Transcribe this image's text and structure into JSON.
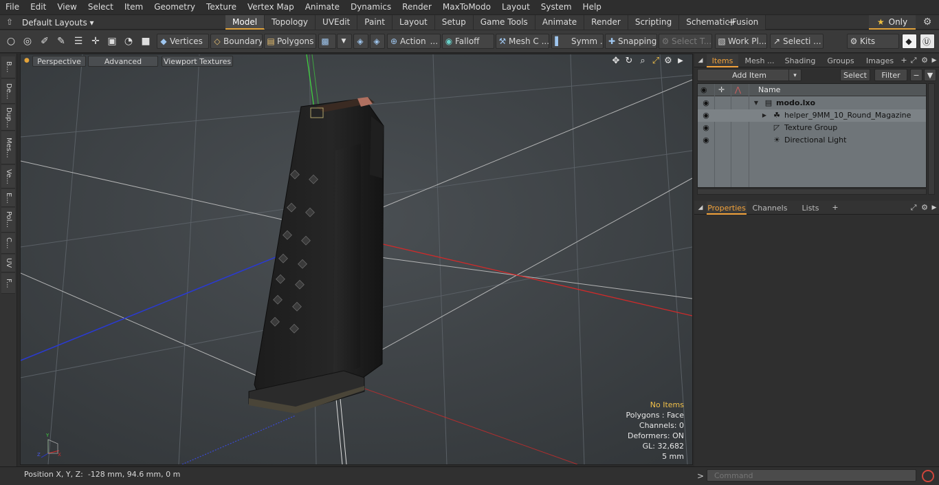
{
  "menu": [
    "File",
    "Edit",
    "View",
    "Select",
    "Item",
    "Geometry",
    "Texture",
    "Vertex Map",
    "Animate",
    "Dynamics",
    "Render",
    "MaxToModo",
    "Layout",
    "System",
    "Help"
  ],
  "layout_bar": {
    "layouts_label": "Default Layouts ▾",
    "tabs": [
      "Model",
      "Topology",
      "UVEdit",
      "Paint",
      "Layout",
      "Setup",
      "Game Tools",
      "Animate",
      "Render",
      "Scripting",
      "Schematic Fusion"
    ],
    "active_tab": "Model",
    "plus": "+",
    "only_label": "Only",
    "star": "★",
    "gear": "⚙"
  },
  "toolbar": {
    "vertices": "Vertices",
    "boundary": "Boundary",
    "polygons": "Polygons",
    "action": "Action",
    "action_more": "...",
    "falloff": "Falloff",
    "mesh_c": "Mesh C ...",
    "symm": "Symm ...",
    "snapping": "Snapping",
    "select_t": "Select T...",
    "work_pl": "Work Pl...",
    "selecti": "Selecti ...",
    "kits": "Kits"
  },
  "left_tabs": [
    "B...",
    "De...",
    "Dup...",
    "Mes...",
    "Ve...",
    "E...",
    "Pol...",
    "C...",
    "UV",
    "F..."
  ],
  "viewport": {
    "tabs": [
      "Perspective",
      "Advanced",
      "Viewport Textures"
    ],
    "info": {
      "no_items": "No Items",
      "polygons": "Polygons : Face",
      "channels": "Channels: 0",
      "deformers": "Deformers: ON",
      "gl": "GL: 32,682",
      "scale": "5 mm"
    },
    "axis_y": "Y",
    "axis_z": "Z",
    "axis_x": "X"
  },
  "items_panel": {
    "tabs": [
      "Items",
      "Mesh ...",
      "Shading",
      "Groups",
      "Images"
    ],
    "active": "Items",
    "plus": "+",
    "add_item": "Add Item",
    "add_item_arrow": "▾",
    "select": "Select",
    "filter": "Filter",
    "col_name": "Name",
    "rows": [
      {
        "label": "modo.lxo",
        "icon": "scene-icon",
        "glyph": "▤",
        "bold": true,
        "arrow": "▼",
        "indent": 0
      },
      {
        "label": "helper_9MM_10_Round_Magazine",
        "icon": "mesh-icon",
        "glyph": "☘",
        "bold": false,
        "arrow": "▶",
        "indent": 1
      },
      {
        "label": "Texture Group",
        "icon": "texture-group-icon",
        "glyph": "◸",
        "bold": false,
        "arrow": "",
        "indent": 1
      },
      {
        "label": "Directional Light",
        "icon": "light-icon",
        "glyph": "☀",
        "bold": false,
        "arrow": "",
        "indent": 1
      }
    ]
  },
  "properties_panel": {
    "tabs": [
      "Properties",
      "Channels",
      "Lists"
    ],
    "active": "Properties",
    "plus": "+"
  },
  "status": {
    "position_label": "Position X, Y, Z:",
    "position_value": "-128 mm, 94.6 mm, 0 m"
  },
  "command": {
    "caret": ">",
    "placeholder": "Command"
  },
  "colors": {
    "accent": "#f2a23a",
    "viewport_bg": "#3e4347",
    "x_axis": "#d02a2a",
    "y_axis": "#3fd03f",
    "z_axis": "#2a3ad0"
  }
}
